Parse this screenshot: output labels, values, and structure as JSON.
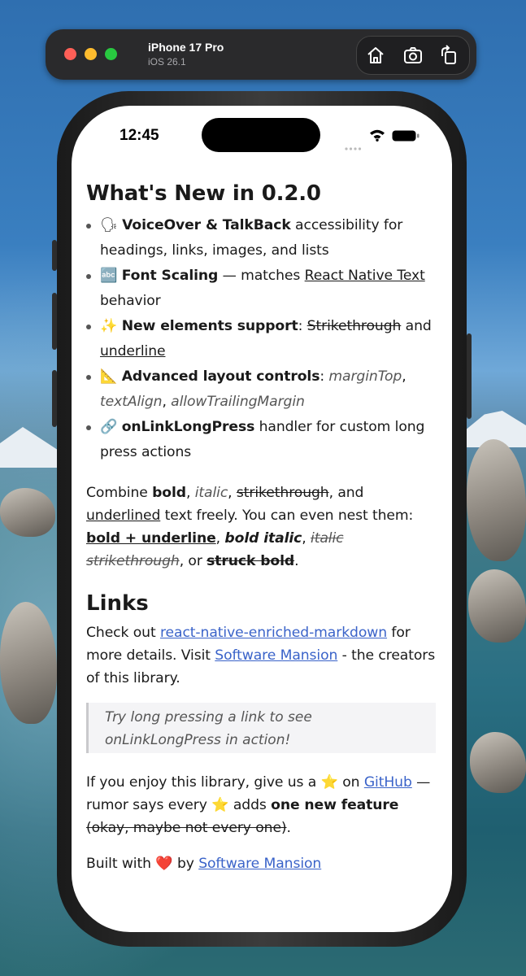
{
  "simulator": {
    "device_name": "iPhone 17 Pro",
    "os_version": "iOS 26.1",
    "tools": [
      "home-icon",
      "screenshot-icon",
      "rotate-icon"
    ]
  },
  "status_bar": {
    "time": "12:45"
  },
  "article": {
    "heading": "What's New in 0.2.0",
    "bullets": {
      "b1": {
        "emoji": "🗣",
        "bold": "VoiceOver & TalkBack",
        "rest": " accessibility for headings, links, images, and lists"
      },
      "b2": {
        "emoji": "🔤",
        "bold": "Font Scaling",
        "mid": " — matches ",
        "underline": "React Native Text",
        "rest": " behavior"
      },
      "b3": {
        "emoji": "✨",
        "bold": "New elements support",
        "colon": ": ",
        "strike": "Strikethrough",
        "and": " and ",
        "underline": "underline"
      },
      "b4": {
        "emoji": "📐",
        "bold": "Advanced layout controls",
        "colon": ": ",
        "i1": "marginTop",
        "comma1": ", ",
        "i2": "textAlign",
        "comma2": ", ",
        "i3": "allowTrailingMargin"
      },
      "b5": {
        "emoji": "🔗",
        "bold": "onLinkLongPress",
        "rest": " handler for custom long press actions"
      }
    },
    "combine": {
      "t1": "Combine ",
      "bold": "bold",
      "c1": ", ",
      "italic": "italic",
      "c2": ", ",
      "strike": "strikethrough",
      "t2": ", and ",
      "underlined": "underlined",
      "t3": " text freely. You can even nest them: ",
      "bold_underline": "bold + underline",
      "c3": ", ",
      "bold_italic": "bold italic",
      "c4": ", ",
      "italic_strike": "italic strikethrough",
      "t4": ", or ",
      "struck_bold": "struck bold",
      "end": "."
    },
    "links_heading": "Links",
    "links_para": {
      "t1": "Check out ",
      "link1": "react-native-enriched-markdown",
      "t2": " for more details. Visit ",
      "link2": "Software Mansion",
      "t3": " - the creators of this library."
    },
    "quote": "Try long pressing a link to see onLinkLongPress in action!",
    "enjoy": {
      "t1": "If you enjoy this library, give us a ",
      "star1": "⭐",
      "t2": " on ",
      "link": "GitHub",
      "t3": " — rumor says every ",
      "star2": "⭐",
      "t4": " adds ",
      "bold": "one new feature",
      "t5": " ",
      "strike": "(okay, maybe not every one)",
      "end": "."
    },
    "built": {
      "t1": "Built with ",
      "heart": "❤️",
      "t2": " by ",
      "link": "Software Mansion"
    }
  },
  "colors": {
    "link": "#3a63c9",
    "page_bg": "#ffffff",
    "text": "#1a1a1a"
  }
}
